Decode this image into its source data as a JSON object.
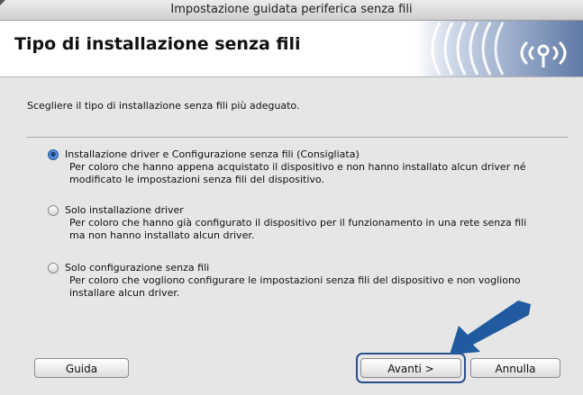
{
  "window": {
    "title": "Impostazione guidata periferica senza fili"
  },
  "header": {
    "heading": "Tipo di installazione senza fili"
  },
  "main": {
    "instruction": "Scegliere il tipo di installazione senza fili più adeguato.",
    "options": [
      {
        "label": "Installazione driver e Configurazione senza fili (Consigliata)",
        "description": "Per coloro che hanno appena acquistato il dispositivo e non hanno installato alcun driver né modificato le impostazioni senza fili del dispositivo.",
        "selected": true
      },
      {
        "label": "Solo installazione driver",
        "description": "Per coloro che hanno già configurato il dispositivo per il funzionamento in una rete senza fili ma non hanno installato alcun driver.",
        "selected": false
      },
      {
        "label": "Solo configurazione senza fili",
        "description": "Per coloro che vogliono configurare le impostazioni senza fili del dispositivo e non vogliono installare alcun driver.",
        "selected": false
      }
    ]
  },
  "footer": {
    "help_label": "Guida",
    "next_label": "Avanti >",
    "cancel_label": "Annulla"
  },
  "icons": {
    "header_logo": "wireless-signal-icon",
    "pointer": "arrow-pointer-icon"
  },
  "colors": {
    "accent": "#2a66bf",
    "arrow": "#1f5b9e",
    "highlight": "#2a4f8c"
  }
}
